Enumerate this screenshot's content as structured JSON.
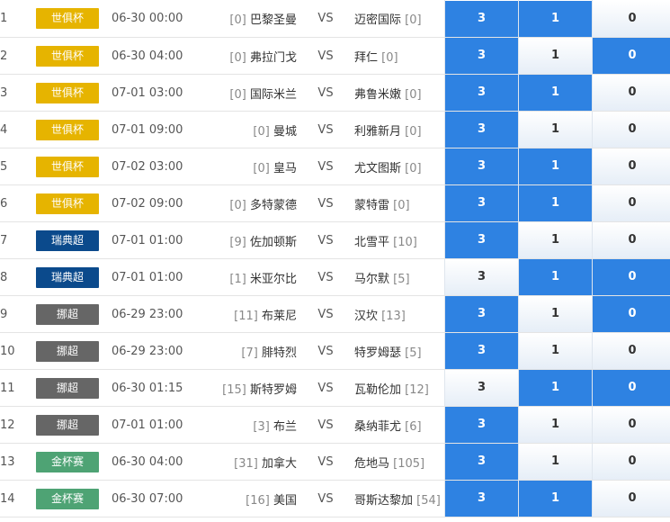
{
  "colors": {
    "selected": "#2e82e2",
    "league": {
      "世俱杯": "#e6b400",
      "瑞典超": "#0b4a8c",
      "挪超": "#666666",
      "金杯赛": "#4ea374"
    }
  },
  "vs_label": "VS",
  "rows": [
    {
      "index": "1",
      "league": "世俱杯",
      "time": "06-30 00:00",
      "home_rank": "[0]",
      "home": "巴黎圣曼",
      "away": "迈密国际",
      "away_rank": "[0]",
      "odds": [
        {
          "label": "3",
          "selected": true
        },
        {
          "label": "1",
          "selected": true
        },
        {
          "label": "0",
          "selected": false
        }
      ]
    },
    {
      "index": "2",
      "league": "世俱杯",
      "time": "06-30 04:00",
      "home_rank": "[0]",
      "home": "弗拉门戈",
      "away": "拜仁",
      "away_rank": "[0]",
      "odds": [
        {
          "label": "3",
          "selected": true
        },
        {
          "label": "1",
          "selected": false
        },
        {
          "label": "0",
          "selected": true
        }
      ]
    },
    {
      "index": "3",
      "league": "世俱杯",
      "time": "07-01 03:00",
      "home_rank": "[0]",
      "home": "国际米兰",
      "away": "弗鲁米嫩",
      "away_rank": "[0]",
      "odds": [
        {
          "label": "3",
          "selected": true
        },
        {
          "label": "1",
          "selected": true
        },
        {
          "label": "0",
          "selected": false
        }
      ]
    },
    {
      "index": "4",
      "league": "世俱杯",
      "time": "07-01 09:00",
      "home_rank": "[0]",
      "home": "曼城",
      "away": "利雅新月",
      "away_rank": "[0]",
      "odds": [
        {
          "label": "3",
          "selected": true
        },
        {
          "label": "1",
          "selected": false
        },
        {
          "label": "0",
          "selected": false
        }
      ]
    },
    {
      "index": "5",
      "league": "世俱杯",
      "time": "07-02 03:00",
      "home_rank": "[0]",
      "home": "皇马",
      "away": "尤文图斯",
      "away_rank": "[0]",
      "odds": [
        {
          "label": "3",
          "selected": true
        },
        {
          "label": "1",
          "selected": true
        },
        {
          "label": "0",
          "selected": false
        }
      ]
    },
    {
      "index": "6",
      "league": "世俱杯",
      "time": "07-02 09:00",
      "home_rank": "[0]",
      "home": "多特蒙德",
      "away": "蒙特雷",
      "away_rank": "[0]",
      "odds": [
        {
          "label": "3",
          "selected": true
        },
        {
          "label": "1",
          "selected": true
        },
        {
          "label": "0",
          "selected": false
        }
      ]
    },
    {
      "index": "7",
      "league": "瑞典超",
      "time": "07-01 01:00",
      "home_rank": "[9]",
      "home": "佐加顿斯",
      "away": "北雪平",
      "away_rank": "[10]",
      "odds": [
        {
          "label": "3",
          "selected": true
        },
        {
          "label": "1",
          "selected": false
        },
        {
          "label": "0",
          "selected": false
        }
      ]
    },
    {
      "index": "8",
      "league": "瑞典超",
      "time": "07-01 01:00",
      "home_rank": "[1]",
      "home": "米亚尔比",
      "away": "马尔默",
      "away_rank": "[5]",
      "odds": [
        {
          "label": "3",
          "selected": false
        },
        {
          "label": "1",
          "selected": true
        },
        {
          "label": "0",
          "selected": true
        }
      ]
    },
    {
      "index": "9",
      "league": "挪超",
      "time": "06-29 23:00",
      "home_rank": "[11]",
      "home": "布莱尼",
      "away": "汉坎",
      "away_rank": "[13]",
      "odds": [
        {
          "label": "3",
          "selected": true
        },
        {
          "label": "1",
          "selected": false
        },
        {
          "label": "0",
          "selected": true
        }
      ]
    },
    {
      "index": "10",
      "league": "挪超",
      "time": "06-29 23:00",
      "home_rank": "[7]",
      "home": "腓特烈",
      "away": "特罗姆瑟",
      "away_rank": "[5]",
      "odds": [
        {
          "label": "3",
          "selected": true
        },
        {
          "label": "1",
          "selected": false
        },
        {
          "label": "0",
          "selected": false
        }
      ]
    },
    {
      "index": "11",
      "league": "挪超",
      "time": "06-30 01:15",
      "home_rank": "[15]",
      "home": "斯特罗姆",
      "away": "瓦勒伦加",
      "away_rank": "[12]",
      "odds": [
        {
          "label": "3",
          "selected": false
        },
        {
          "label": "1",
          "selected": true
        },
        {
          "label": "0",
          "selected": true
        }
      ]
    },
    {
      "index": "12",
      "league": "挪超",
      "time": "07-01 01:00",
      "home_rank": "[3]",
      "home": "布兰",
      "away": "桑纳菲尤",
      "away_rank": "[6]",
      "odds": [
        {
          "label": "3",
          "selected": true
        },
        {
          "label": "1",
          "selected": false
        },
        {
          "label": "0",
          "selected": false
        }
      ]
    },
    {
      "index": "13",
      "league": "金杯赛",
      "time": "06-30 04:00",
      "home_rank": "[31]",
      "home": "加拿大",
      "away": "危地马",
      "away_rank": "[105]",
      "odds": [
        {
          "label": "3",
          "selected": true
        },
        {
          "label": "1",
          "selected": false
        },
        {
          "label": "0",
          "selected": false
        }
      ]
    },
    {
      "index": "14",
      "league": "金杯赛",
      "time": "06-30 07:00",
      "home_rank": "[16]",
      "home": "美国",
      "away": "哥斯达黎加",
      "away_rank": "[54]",
      "odds": [
        {
          "label": "3",
          "selected": true
        },
        {
          "label": "1",
          "selected": true
        },
        {
          "label": "0",
          "selected": false
        }
      ]
    }
  ]
}
